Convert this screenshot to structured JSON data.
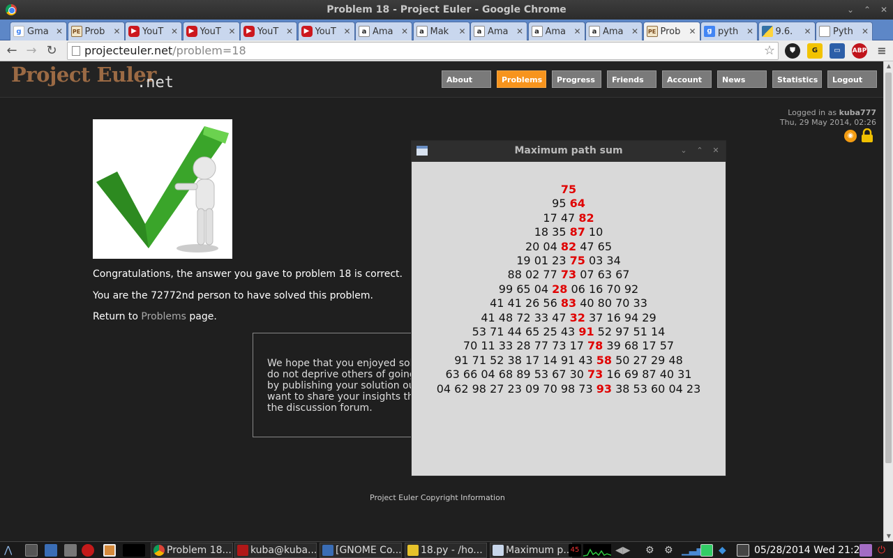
{
  "window": {
    "title": "Problem 18 - Project Euler - Google Chrome"
  },
  "tabs": [
    {
      "label": "Gma",
      "favicon": "gmail-icon"
    },
    {
      "label": "Prob",
      "favicon": "project-euler-icon"
    },
    {
      "label": "YouT",
      "favicon": "youtube-icon"
    },
    {
      "label": "YouT",
      "favicon": "youtube-icon"
    },
    {
      "label": "YouT",
      "favicon": "youtube-icon"
    },
    {
      "label": "YouT",
      "favicon": "youtube-icon"
    },
    {
      "label": "Ama",
      "favicon": "amazon-icon"
    },
    {
      "label": "Mak",
      "favicon": "amazon-icon"
    },
    {
      "label": "Ama",
      "favicon": "amazon-icon"
    },
    {
      "label": "Ama",
      "favicon": "amazon-icon"
    },
    {
      "label": "Ama",
      "favicon": "amazon-icon"
    },
    {
      "label": "Prob",
      "favicon": "project-euler-icon",
      "active": true
    },
    {
      "label": "pyth",
      "favicon": "google-icon"
    },
    {
      "label": "9.6.",
      "favicon": "python-icon"
    },
    {
      "label": "Pyth",
      "favicon": "document-icon"
    }
  ],
  "address": {
    "host": "projecteuler.net",
    "path": "/problem=18"
  },
  "site": {
    "logo": "Project Euler",
    "logo_suffix": ".net",
    "nav": [
      "About",
      "Problems",
      "Progress",
      "Friends",
      "Account",
      "News",
      "Statistics",
      "Logout"
    ],
    "active_nav": "Problems",
    "logged_in_prefix": "Logged in as",
    "username": "kuba777",
    "datetime": "Thu, 29 May 2014, 02:26",
    "congrats": "Congratulations, the answer you gave to problem 18 is correct.",
    "solver_text": "You are the 72772nd person to have solved this problem.",
    "return_prefix": "Return to",
    "return_link": "Problems",
    "return_suffix": "page.",
    "note": "We hope that you enjoyed solving\ndo not deprive others of going th\nby publishing your solution outsi\nwant to share your insights then\nthe discussion forum.",
    "footer": "Project Euler Copyright Information"
  },
  "popup": {
    "title": "Maximum path sum",
    "rows": [
      {
        "pre": "",
        "hl": "75",
        "post": ""
      },
      {
        "pre": "95 ",
        "hl": "64",
        "post": ""
      },
      {
        "pre": "17 47 ",
        "hl": "82",
        "post": ""
      },
      {
        "pre": "18 35 ",
        "hl": "87",
        "post": " 10"
      },
      {
        "pre": "20 04 ",
        "hl": "82",
        "post": " 47 65"
      },
      {
        "pre": "19 01 23 ",
        "hl": "75",
        "post": " 03 34"
      },
      {
        "pre": "88 02 77 ",
        "hl": "73",
        "post": " 07 63 67"
      },
      {
        "pre": "99 65 04 ",
        "hl": "28",
        "post": " 06 16 70 92"
      },
      {
        "pre": "41 41 26 56 ",
        "hl": "83",
        "post": " 40 80 70 33"
      },
      {
        "pre": "41 48 72 33 47 ",
        "hl": "32",
        "post": " 37 16 94 29"
      },
      {
        "pre": "53 71 44 65 25 43 ",
        "hl": "91",
        "post": " 52 97 51 14"
      },
      {
        "pre": "70 11 33 28 77 73 17 ",
        "hl": "78",
        "post": " 39 68 17 57"
      },
      {
        "pre": "91 71 52 38 17 14 91 43 ",
        "hl": "58",
        "post": " 50 27 29 48"
      },
      {
        "pre": "63 66 04 68 89 53 67 30 ",
        "hl": "73",
        "post": " 16 69 87 40 31"
      },
      {
        "pre": "04 62 98 27 23 09 70 98 73 ",
        "hl": "93",
        "post": " 38 53 60 04 23"
      }
    ]
  },
  "taskbar": {
    "tasks": [
      "Problem 18...",
      "kuba@kuba...",
      "[GNOME Co...",
      "18.py - /ho...",
      "Maximum p..."
    ],
    "cpu_badge": "45",
    "clock": "05/28/2014 Wed 21:26"
  },
  "colors": {
    "accent": "#f7941d",
    "highlight": "#e00000",
    "tabstrip": "#5d87c7"
  }
}
